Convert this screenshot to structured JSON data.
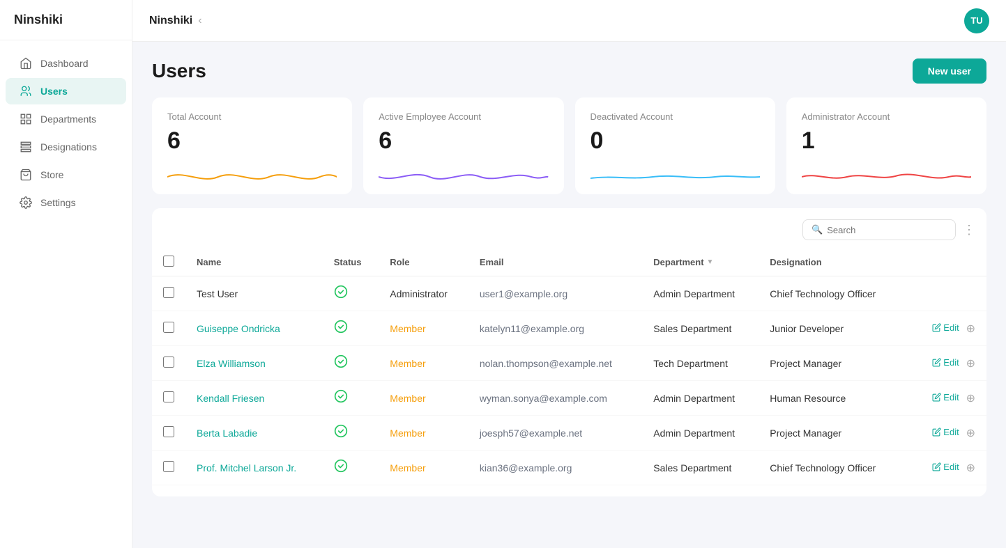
{
  "app": {
    "name": "Ninshiki",
    "avatar_initials": "TU"
  },
  "sidebar": {
    "items": [
      {
        "id": "dashboard",
        "label": "Dashboard",
        "active": false
      },
      {
        "id": "users",
        "label": "Users",
        "active": true
      },
      {
        "id": "departments",
        "label": "Departments",
        "active": false
      },
      {
        "id": "designations",
        "label": "Designations",
        "active": false
      },
      {
        "id": "store",
        "label": "Store",
        "active": false
      },
      {
        "id": "settings",
        "label": "Settings",
        "active": false
      }
    ]
  },
  "page": {
    "title": "Users",
    "new_user_button": "New user"
  },
  "stats": [
    {
      "label": "Total Account",
      "value": "6",
      "color": "#f59e0b"
    },
    {
      "label": "Active Employee Account",
      "value": "6",
      "color": "#8b5cf6"
    },
    {
      "label": "Deactivated Account",
      "value": "0",
      "color": "#38bdf8"
    },
    {
      "label": "Administrator Account",
      "value": "1",
      "color": "#ef4444"
    }
  ],
  "search": {
    "placeholder": "Search"
  },
  "table": {
    "columns": [
      "",
      "Name",
      "Status",
      "Role",
      "Email",
      "Department",
      "Designation",
      ""
    ],
    "rows": [
      {
        "name": "Test User",
        "status": "active",
        "role": "Administrator",
        "role_type": "admin",
        "email": "user1@example.org",
        "department": "Admin Department",
        "designation": "Chief Technology Officer",
        "show_actions": false
      },
      {
        "name": "Guiseppe Ondricka",
        "status": "active",
        "role": "Member",
        "role_type": "member",
        "email": "katelyn11@example.org",
        "department": "Sales Department",
        "designation": "Junior Developer",
        "show_actions": true
      },
      {
        "name": "Elza Williamson",
        "status": "active",
        "role": "Member",
        "role_type": "member",
        "email": "nolan.thompson@example.net",
        "department": "Tech Department",
        "designation": "Project Manager",
        "show_actions": true
      },
      {
        "name": "Kendall Friesen",
        "status": "active",
        "role": "Member",
        "role_type": "member",
        "email": "wyman.sonya@example.com",
        "department": "Admin Department",
        "designation": "Human Resource",
        "show_actions": true
      },
      {
        "name": "Berta Labadie",
        "status": "active",
        "role": "Member",
        "role_type": "member",
        "email": "joesph57@example.net",
        "department": "Admin Department",
        "designation": "Project Manager",
        "show_actions": true
      },
      {
        "name": "Prof. Mitchel Larson Jr.",
        "status": "active",
        "role": "Member",
        "role_type": "member",
        "email": "kian36@example.org",
        "department": "Sales Department",
        "designation": "Chief Technology Officer",
        "show_actions": true
      }
    ],
    "edit_label": "Edit"
  }
}
